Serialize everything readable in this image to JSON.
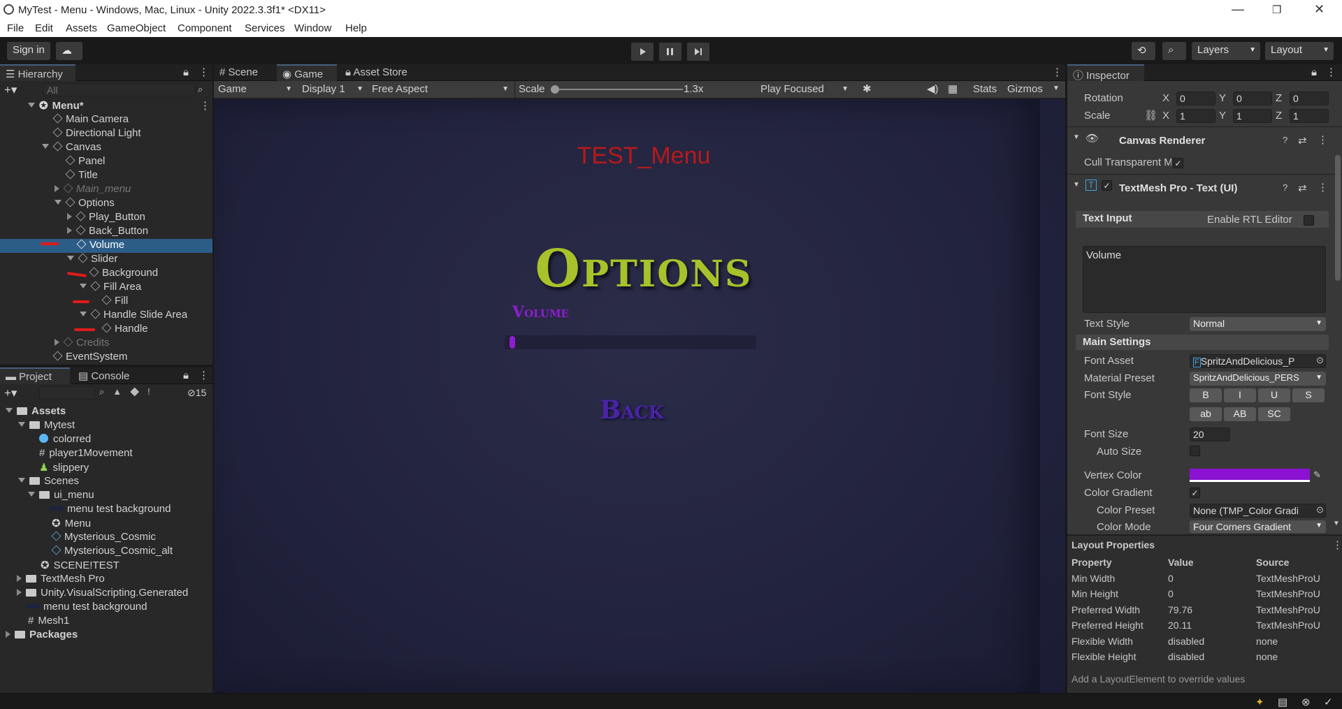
{
  "window": {
    "title": "MyTest - Menu - Windows, Mac, Linux - Unity 2022.3.3f1* <DX11>"
  },
  "menu": [
    "File",
    "Edit",
    "Assets",
    "GameObject",
    "Component",
    "Services",
    "Window",
    "Help"
  ],
  "toolbar": {
    "signin": "Sign in",
    "layers": "Layers",
    "layout": "Layout"
  },
  "hierarchy": {
    "tab": "Hierarchy",
    "search_placeholder": "All",
    "scene": "Menu*",
    "items": [
      {
        "label": "Main Camera"
      },
      {
        "label": "Directional Light"
      },
      {
        "label": "Canvas"
      },
      {
        "label": "Panel"
      },
      {
        "label": "Title"
      },
      {
        "label": "Main_menu"
      },
      {
        "label": "Options"
      },
      {
        "label": "Play_Button"
      },
      {
        "label": "Back_Button"
      },
      {
        "label": "Volume"
      },
      {
        "label": "Slider"
      },
      {
        "label": "Background"
      },
      {
        "label": "Fill Area"
      },
      {
        "label": "Fill"
      },
      {
        "label": "Handle Slide Area"
      },
      {
        "label": "Handle"
      },
      {
        "label": "Credits"
      },
      {
        "label": "EventSystem"
      }
    ]
  },
  "project": {
    "tabs": [
      "Project",
      "Console"
    ],
    "hidden_count": "15",
    "items": [
      {
        "label": "Assets"
      },
      {
        "label": "Mytest"
      },
      {
        "label": "colorred"
      },
      {
        "label": "player1Movement"
      },
      {
        "label": "slippery"
      },
      {
        "label": "Scenes"
      },
      {
        "label": "ui_menu"
      },
      {
        "label": "menu test background"
      },
      {
        "label": "Menu"
      },
      {
        "label": "Mysterious_Cosmic"
      },
      {
        "label": "Mysterious_Cosmic_alt"
      },
      {
        "label": "SCENE!TEST"
      },
      {
        "label": "TextMesh Pro"
      },
      {
        "label": "Unity.VisualScripting.Generated"
      },
      {
        "label": "menu test background"
      },
      {
        "label": "Mesh1"
      },
      {
        "label": "Packages"
      }
    ]
  },
  "game": {
    "tabs": [
      "Scene",
      "Game",
      "Asset Store"
    ],
    "mode": "Game",
    "display": "Display 1",
    "aspect": "Free Aspect",
    "scale_label": "Scale",
    "scale_value": "1.3x",
    "play_focused": "Play Focused",
    "stats": "Stats",
    "gizmos": "Gizmos",
    "title_text": "TEST_Menu",
    "options_text": "Options",
    "volume_text": "Volume",
    "back_text": "Back",
    "slider_fill": 0.02
  },
  "inspector": {
    "tab": "Inspector",
    "rotation": {
      "label": "Rotation",
      "x": "0",
      "y": "0",
      "z": "0"
    },
    "scale": {
      "label": "Scale",
      "x": "1",
      "y": "1",
      "z": "1"
    },
    "xyz": {
      "x": "X",
      "y": "Y",
      "z": "Z"
    },
    "canvas_renderer": "Canvas Renderer",
    "cull": "Cull Transparent Me",
    "tmp": "TextMesh Pro - Text (UI)",
    "text_input": "Text Input",
    "rtl": "Enable RTL Editor",
    "text_value": "Volume",
    "text_style_label": "Text Style",
    "text_style": "Normal",
    "main_settings": "Main Settings",
    "font_asset_label": "Font Asset",
    "font_asset": "SpritzAndDelicious_P",
    "material_preset_label": "Material Preset",
    "material_preset": "SpritzAndDelicious_PERS",
    "font_style_label": "Font Style",
    "styles1": [
      "B",
      "I",
      "U",
      "S"
    ],
    "styles2": [
      "ab",
      "AB",
      "SC"
    ],
    "font_size_label": "Font Size",
    "font_size": "20",
    "auto_size": "Auto Size",
    "vertex_color_label": "Vertex Color",
    "vertex_color": "#8a12d0",
    "color_gradient": "Color Gradient",
    "color_preset_label": "Color Preset",
    "color_preset": "None (TMP_Color Gradi",
    "color_mode_label": "Color Mode",
    "color_mode": "Four Corners Gradient",
    "layout_title": "Layout Properties",
    "layout_headers": [
      "Property",
      "Value",
      "Source"
    ],
    "layout_rows": [
      [
        "Min Width",
        "0",
        "TextMeshProU"
      ],
      [
        "Min Height",
        "0",
        "TextMeshProU"
      ],
      [
        "Preferred Width",
        "79.76",
        "TextMeshProU"
      ],
      [
        "Preferred Height",
        "20.11",
        "TextMeshProU"
      ],
      [
        "Flexible Width",
        "disabled",
        "none"
      ],
      [
        "Flexible Height",
        "disabled",
        "none"
      ]
    ],
    "layout_hint": "Add a LayoutElement to override values"
  }
}
